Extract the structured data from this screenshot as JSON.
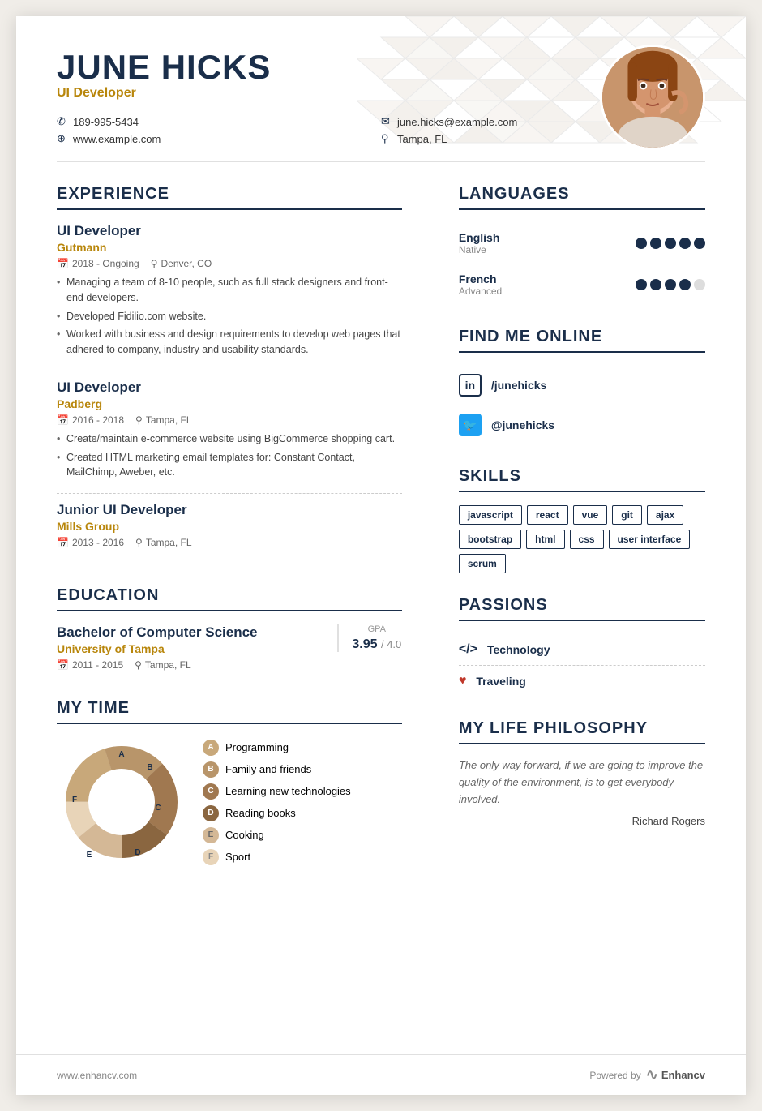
{
  "header": {
    "name": "JUNE HICKS",
    "title": "UI Developer",
    "phone": "189-995-5434",
    "email": "june.hicks@example.com",
    "website": "www.example.com",
    "location": "Tampa, FL"
  },
  "experience": {
    "section_title": "EXPERIENCE",
    "items": [
      {
        "role": "UI Developer",
        "company": "Gutmann",
        "period": "2018 - Ongoing",
        "location": "Denver, CO",
        "bullets": [
          "Managing a team of 8-10 people, such as full stack designers and front-end developers.",
          "Developed Fidilio.com website.",
          "Worked with business and design requirements to develop web pages that adhered to company, industry and usability standards."
        ]
      },
      {
        "role": "UI Developer",
        "company": "Padberg",
        "period": "2016 - 2018",
        "location": "Tampa, FL",
        "bullets": [
          "Create/maintain e-commerce website using BigCommerce shopping cart.",
          "Created HTML marketing email templates for: Constant Contact, MailChimp, Aweber, etc."
        ]
      },
      {
        "role": "Junior UI Developer",
        "company": "Mills Group",
        "period": "2013 - 2016",
        "location": "Tampa, FL",
        "bullets": []
      }
    ]
  },
  "education": {
    "section_title": "EDUCATION",
    "degree": "Bachelor of Computer Science",
    "school": "University of Tampa",
    "period": "2011 - 2015",
    "location": "Tampa, FL",
    "gpa_label": "GPA",
    "gpa_value": "3.95",
    "gpa_max": "/ 4.0"
  },
  "mytime": {
    "section_title": "MY TIME",
    "items": [
      {
        "label": "A",
        "name": "Programming",
        "color": "#c8a87a",
        "value": 20
      },
      {
        "label": "B",
        "name": "Family and friends",
        "color": "#b8956a",
        "value": 18
      },
      {
        "label": "C",
        "name": "Learning new technologies",
        "color": "#a07850",
        "value": 22
      },
      {
        "label": "D",
        "name": "Reading books",
        "color": "#8a6640",
        "value": 15
      },
      {
        "label": "E",
        "name": "Cooking",
        "color": "#d4b896",
        "value": 14
      },
      {
        "label": "F",
        "name": "Sport",
        "color": "#e8d4b8",
        "value": 11
      }
    ]
  },
  "languages": {
    "section_title": "LANGUAGES",
    "items": [
      {
        "name": "English",
        "level": "Native",
        "dots": 5,
        "filled": 5
      },
      {
        "name": "French",
        "level": "Advanced",
        "dots": 5,
        "filled": 4
      }
    ]
  },
  "find_online": {
    "section_title": "FIND ME ONLINE",
    "items": [
      {
        "platform": "linkedin",
        "handle": "/junehicks"
      },
      {
        "platform": "twitter",
        "handle": "@junehicks"
      }
    ]
  },
  "skills": {
    "section_title": "SKILLS",
    "items": [
      "javascript",
      "react",
      "vue",
      "git",
      "ajax",
      "bootstrap",
      "html",
      "css",
      "user interface",
      "scrum"
    ]
  },
  "passions": {
    "section_title": "PASSIONS",
    "items": [
      {
        "icon": "code",
        "name": "Technology"
      },
      {
        "icon": "heart",
        "name": "Traveling"
      }
    ]
  },
  "philosophy": {
    "section_title": "MY LIFE PHILOSOPHY",
    "text": "The only way forward, if we are going to improve the quality of the environment, is to get everybody involved.",
    "author": "Richard Rogers"
  },
  "footer": {
    "website": "www.enhancv.com",
    "powered_by": "Powered by",
    "brand": "Enhancv"
  }
}
